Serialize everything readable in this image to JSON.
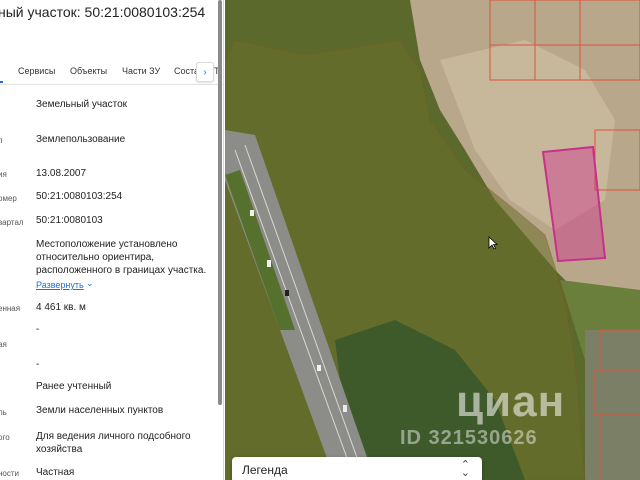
{
  "panel": {
    "title": "ный участок: 50:21:0080103:254",
    "tabs": [
      {
        "label": "Сервисы"
      },
      {
        "label": "Объекты"
      },
      {
        "label": "Части ЗУ"
      },
      {
        "label": "Соста"
      }
    ],
    "tab_cut": "Т",
    "tab_scroll_icon": "›",
    "rows": [
      {
        "key": "",
        "value": "Земельный участок"
      },
      {
        "key": "п",
        "value": "Землепользование"
      },
      {
        "key": "ия",
        "value": "13.08.2007"
      },
      {
        "key": "омер",
        "value": "50:21:0080103:254"
      },
      {
        "key": "вартал",
        "value": "50:21:0080103"
      },
      {
        "key": "",
        "value": "Местоположение установлено относительно ориентира, расположенного в границах участка."
      },
      {
        "key": "енная",
        "value": "4 461 кв. м"
      },
      {
        "key": "ая",
        "value": "-"
      },
      {
        "key": "",
        "value": "-"
      },
      {
        "key": "",
        "value": "Ранее учтенный"
      },
      {
        "key": "ль",
        "value": "Земли населенных пунктов"
      },
      {
        "key": "ого",
        "value": "Для ведения личного подсобного хозяйства"
      },
      {
        "key": "ности",
        "value": "Частная"
      }
    ],
    "expand_link": "Развернуть",
    "expand_icon": "⌄"
  },
  "map": {
    "watermark_brand": "циан",
    "watermark_id": "ID 321530626",
    "legend_label": "Легенда",
    "legend_icon": "⌃⌄",
    "highlight_color": "#d0368f",
    "parcel_border_color": "#e0503a"
  }
}
